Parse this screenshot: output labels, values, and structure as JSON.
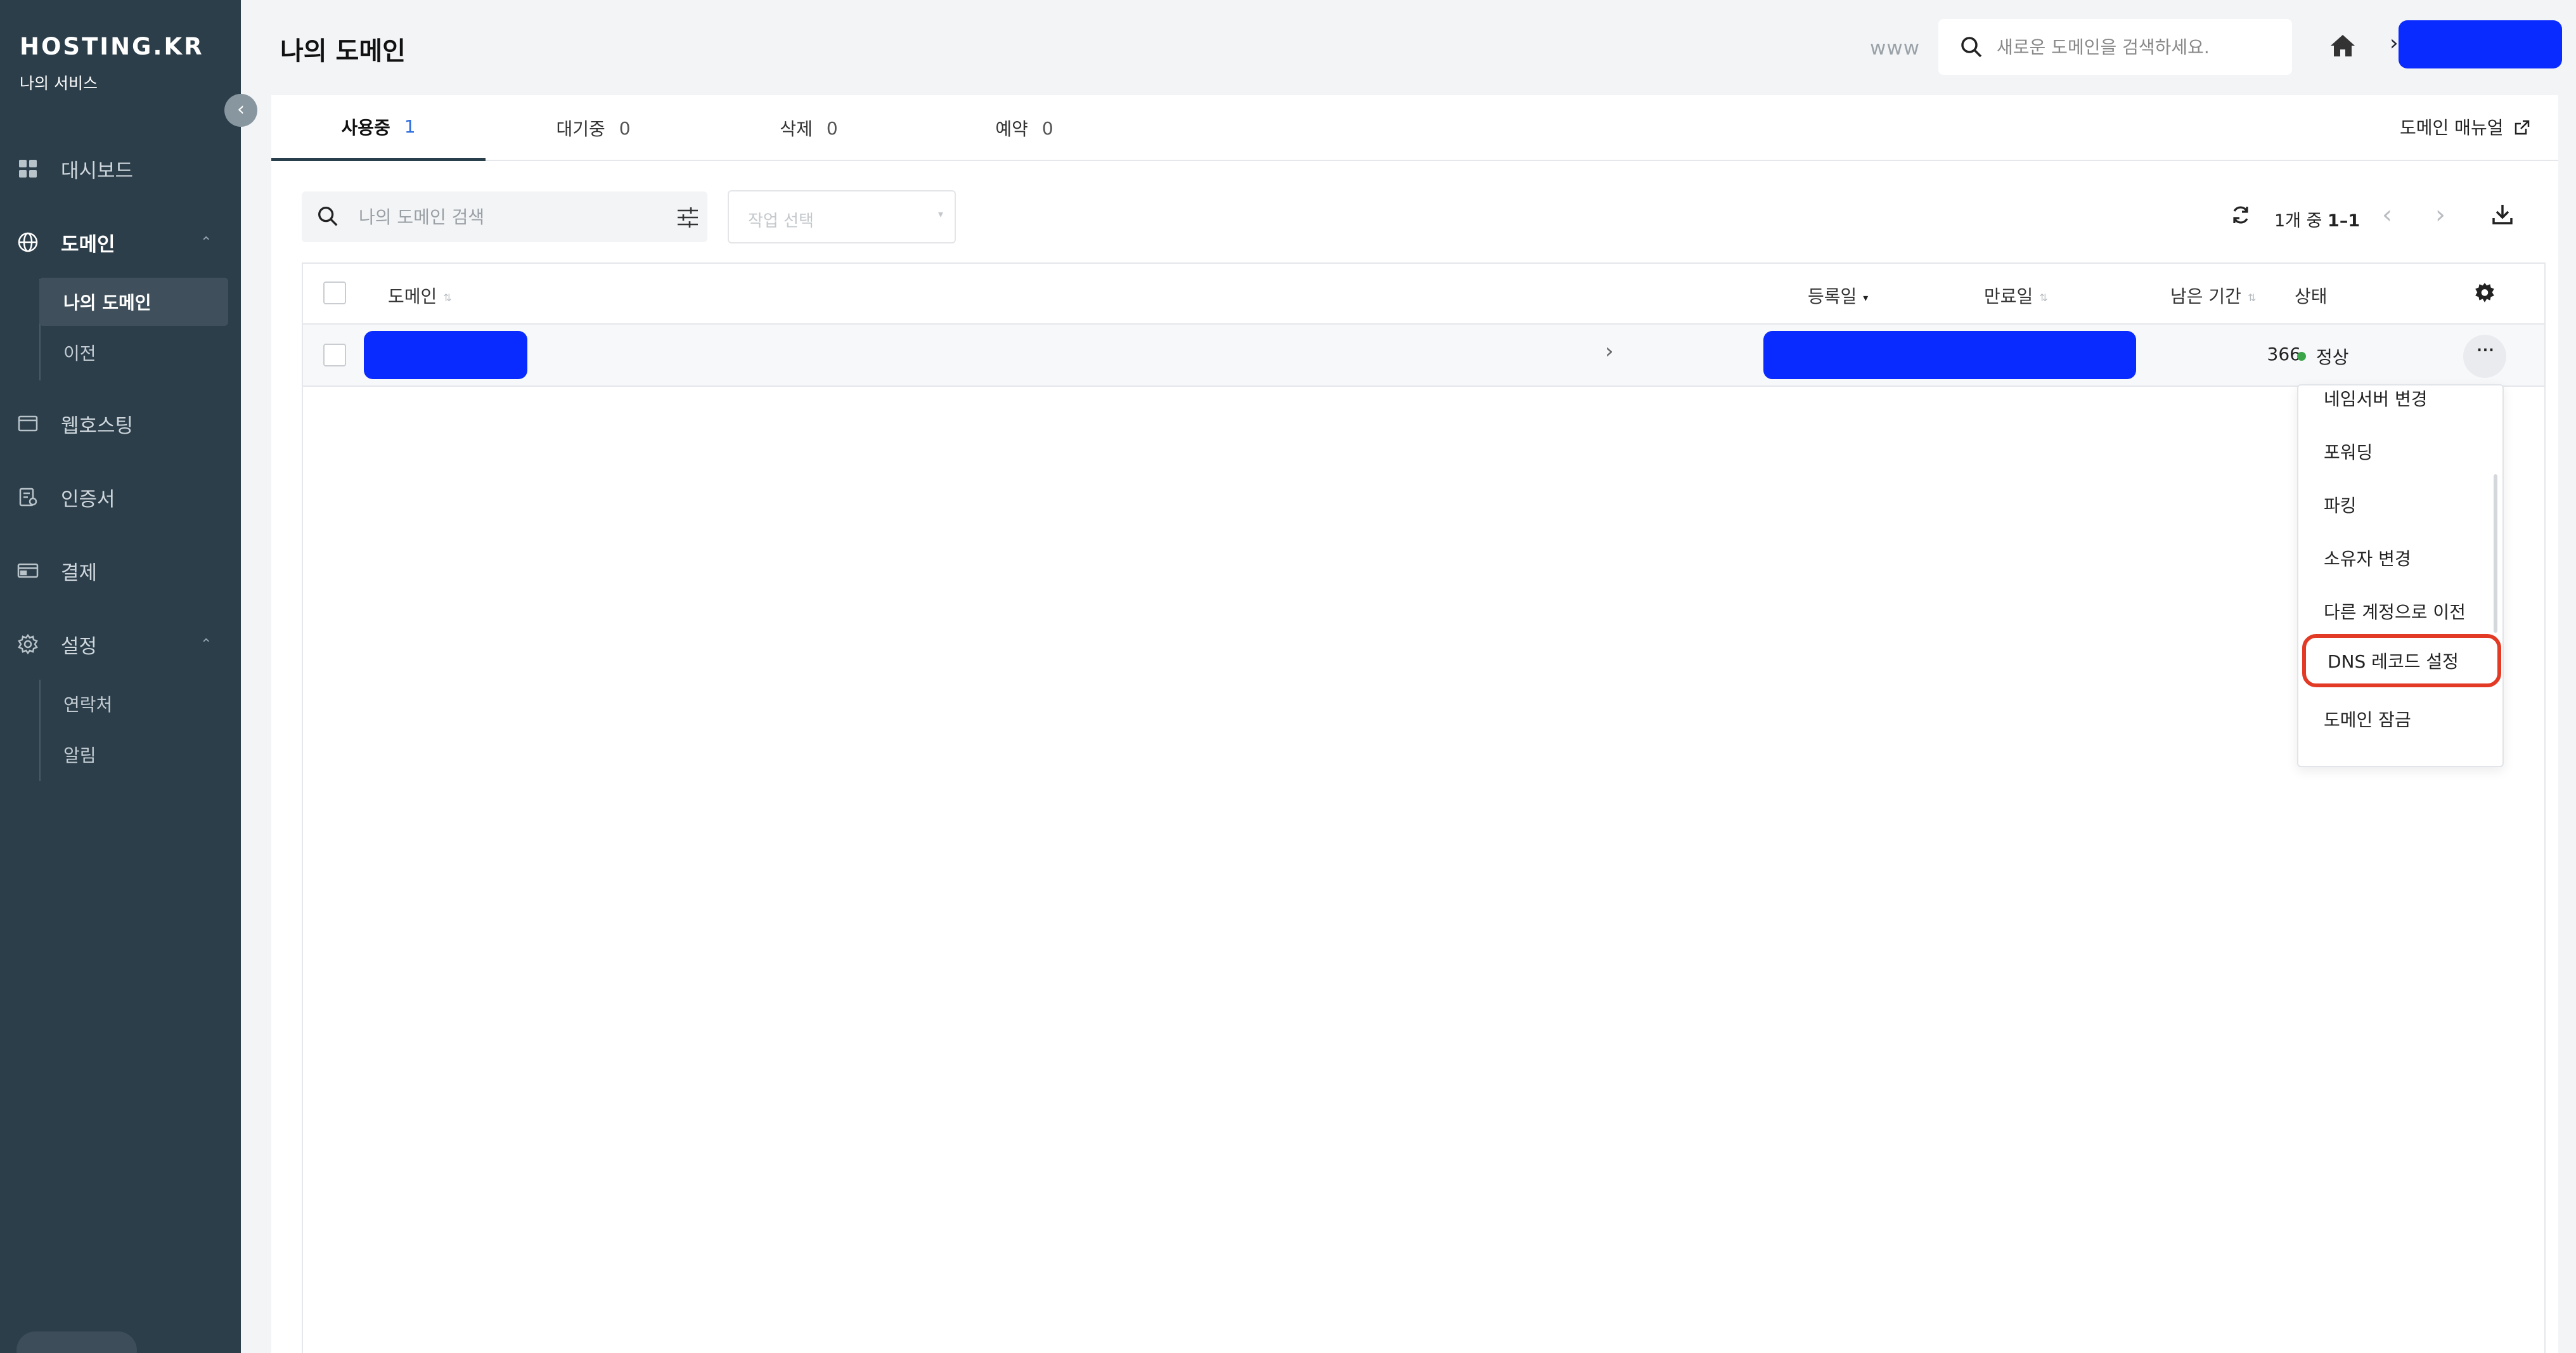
{
  "brand": {
    "logo": "HOSTING.KR",
    "subtitle": "나의 서비스"
  },
  "sidebar": {
    "items": [
      {
        "label": "대시보드",
        "icon": "dashboard-icon"
      },
      {
        "label": "도메인",
        "icon": "globe-icon",
        "expanded": true
      },
      {
        "label": "웹호스팅",
        "icon": "browser-icon"
      },
      {
        "label": "인증서",
        "icon": "certificate-icon"
      },
      {
        "label": "결제",
        "icon": "payment-icon"
      },
      {
        "label": "설정",
        "icon": "settings-icon",
        "expanded": true
      }
    ],
    "domain_sub": [
      "나의 도메인",
      "이전"
    ],
    "settings_sub": [
      "연락처",
      "알림"
    ]
  },
  "header": {
    "title": "나의 도메인",
    "www": "www",
    "search_placeholder": "새로운 도메인을 검색하세요."
  },
  "tabs": [
    {
      "label": "사용중",
      "count": "1",
      "active": true
    },
    {
      "label": "대기중",
      "count": "0"
    },
    {
      "label": "삭제",
      "count": "0"
    },
    {
      "label": "예약",
      "count": "0"
    }
  ],
  "manual_link": "도메인 매뉴얼",
  "toolbar": {
    "search_placeholder": "나의 도메인 검색",
    "action_placeholder": "작업 선택",
    "page_info_prefix": "1개 중 ",
    "page_info_range": "1–1"
  },
  "table": {
    "headers": {
      "domain": "도메인",
      "registered": "등록일",
      "expires": "만료일",
      "remaining": "남은 기간",
      "status": "상태"
    },
    "rows": [
      {
        "remaining": "366",
        "status": "정상",
        "status_color": "#3ba54a"
      }
    ]
  },
  "row_menu": {
    "items": [
      "네임서버 변경",
      "포워딩",
      "파킹",
      "소유자 변경",
      "다른 계정으로 이전",
      "DNS 레코드 설정",
      "도메인 잠금"
    ],
    "highlighted_index": 5
  },
  "colors": {
    "sidebar_bg": "#2c3e4a",
    "redacted_blue": "#0a2bff",
    "highlight_red": "#e23a25"
  }
}
